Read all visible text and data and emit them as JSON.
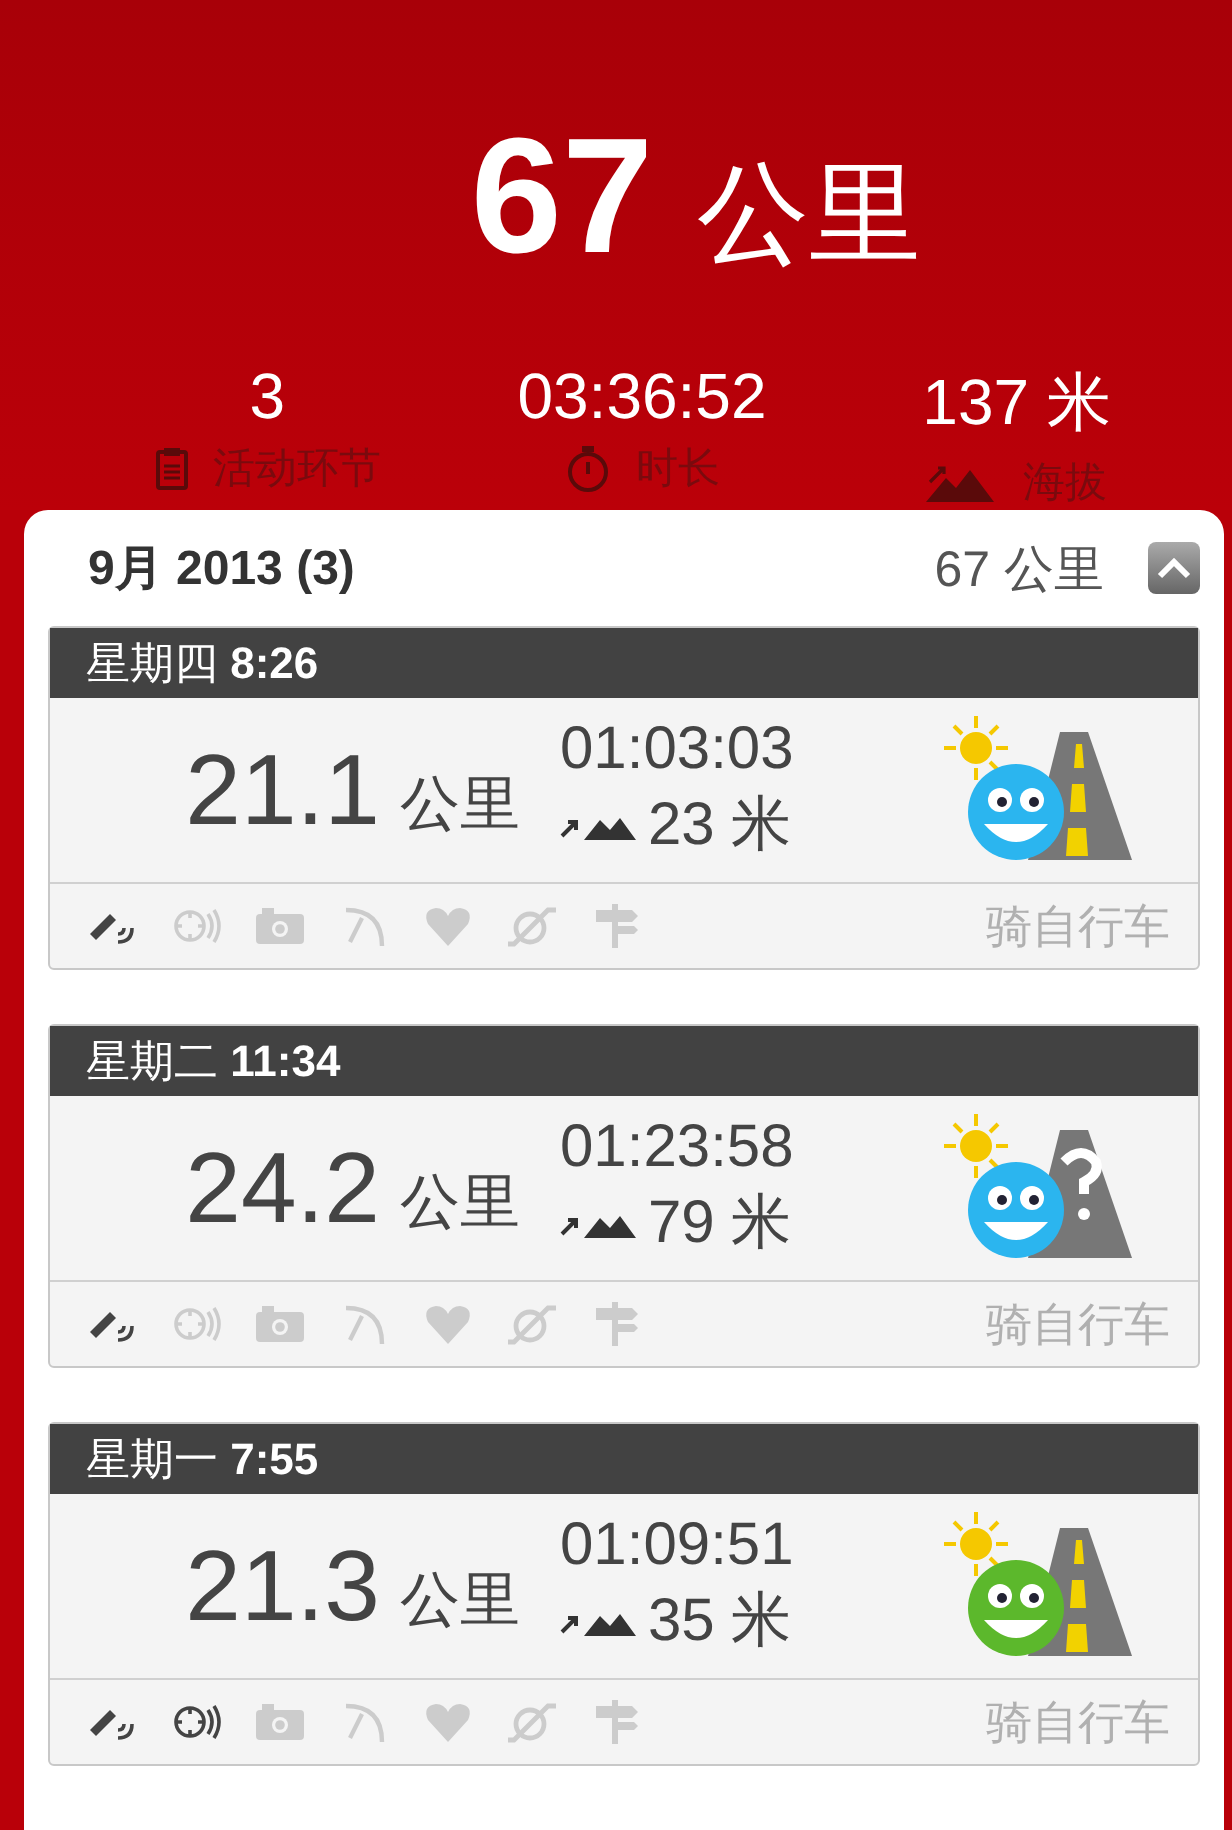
{
  "total": {
    "value": "67",
    "unit": "公里"
  },
  "stats": [
    {
      "kind": "sessions",
      "value": "3",
      "label": "活动环节"
    },
    {
      "kind": "duration",
      "value": "03:36:52",
      "label": "时长"
    },
    {
      "kind": "altitude",
      "value": "137 米",
      "label": "海拔"
    }
  ],
  "month": {
    "title": "9月 2013 (3)",
    "distance": "67 公里",
    "expanded": true
  },
  "rides": [
    {
      "day": "星期四",
      "time": "8:26",
      "distance": "21.1",
      "unit": "公里",
      "duration": "01:03:03",
      "climb": "23 米",
      "mood": {
        "color": "#2bb5ef"
      },
      "route": {
        "kind": "road"
      },
      "sport": "骑自行车",
      "sensors": [
        {
          "kind": "gps",
          "on": true
        },
        {
          "kind": "pod",
          "on": false
        },
        {
          "kind": "camera",
          "on": false
        },
        {
          "kind": "speed",
          "on": false
        },
        {
          "kind": "heart",
          "on": false
        },
        {
          "kind": "cadence",
          "on": false
        },
        {
          "kind": "signpost",
          "on": false
        }
      ]
    },
    {
      "day": "星期二",
      "time": "11:34",
      "distance": "24.2",
      "unit": "公里",
      "duration": "01:23:58",
      "climb": "79 米",
      "mood": {
        "color": "#2bb5ef"
      },
      "route": {
        "kind": "unknown"
      },
      "sport": "骑自行车",
      "sensors": [
        {
          "kind": "gps",
          "on": true
        },
        {
          "kind": "pod",
          "on": false
        },
        {
          "kind": "camera",
          "on": false
        },
        {
          "kind": "speed",
          "on": false
        },
        {
          "kind": "heart",
          "on": false
        },
        {
          "kind": "cadence",
          "on": false
        },
        {
          "kind": "signpost",
          "on": false
        }
      ]
    },
    {
      "day": "星期一",
      "time": "7:55",
      "distance": "21.3",
      "unit": "公里",
      "duration": "01:09:51",
      "climb": "35 米",
      "mood": {
        "color": "#5cb82c"
      },
      "route": {
        "kind": "road"
      },
      "sport": "骑自行车",
      "sensors": [
        {
          "kind": "gps",
          "on": true
        },
        {
          "kind": "pod",
          "on": true
        },
        {
          "kind": "camera",
          "on": false
        },
        {
          "kind": "speed",
          "on": false
        },
        {
          "kind": "heart",
          "on": false
        },
        {
          "kind": "cadence",
          "on": false
        },
        {
          "kind": "signpost",
          "on": false
        }
      ]
    }
  ]
}
